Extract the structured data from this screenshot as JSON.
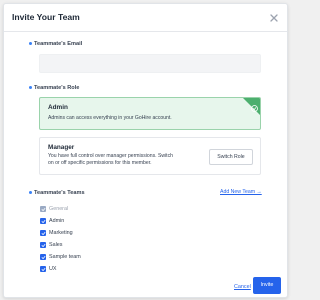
{
  "modal": {
    "title": "Invite Your Team",
    "close_icon": "close-icon"
  },
  "email": {
    "label": "Teammate's Email",
    "value": "",
    "placeholder": ""
  },
  "role": {
    "label": "Teammate's Role",
    "options": [
      {
        "name": "Admin",
        "description": "Admins can access everything in your GoHire account.",
        "selected": true
      },
      {
        "name": "Manager",
        "description_line1": "You have full control over manager permissions. Switch",
        "description_line2": "on or off specific permissions for this member.",
        "selected": false
      }
    ],
    "switch_label": "Switch Role"
  },
  "teams": {
    "label": "Teammate's Teams",
    "add_label": "Add New Team →",
    "items": [
      {
        "label": "General",
        "checked": true,
        "disabled": true
      },
      {
        "label": "Admin",
        "checked": true,
        "disabled": false
      },
      {
        "label": "Marketing",
        "checked": true,
        "disabled": false
      },
      {
        "label": "Sales",
        "checked": true,
        "disabled": false
      },
      {
        "label": "Sample team",
        "checked": true,
        "disabled": false
      },
      {
        "label": "UX",
        "checked": true,
        "disabled": false
      }
    ]
  },
  "footer": {
    "cancel_label": "Cancel",
    "invite_label": "Invite"
  },
  "colors": {
    "accent": "#2563eb",
    "selected_bg": "#e7f6ec",
    "selected_border": "#9ad3ab",
    "selected_marker": "#4caf6e"
  }
}
